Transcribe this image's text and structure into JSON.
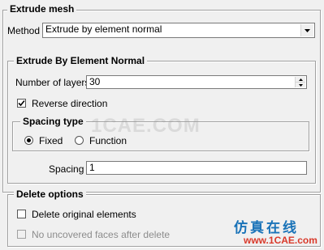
{
  "extrude_mesh": {
    "title": "Extrude mesh",
    "method_label": "Method",
    "method_value": "Extrude by element normal"
  },
  "by_normal": {
    "title": "Extrude By Element Normal",
    "layers_label": "Number of layers",
    "layers_value": "30",
    "reverse_label": "Reverse direction",
    "reverse_checked": true,
    "spacing_type": {
      "title": "Spacing type",
      "fixed_label": "Fixed",
      "function_label": "Function",
      "selected": "Fixed"
    },
    "spacing_label": "Spacing",
    "spacing_value": "1"
  },
  "delete_options": {
    "title": "Delete options",
    "delete_original_label": "Delete original elements",
    "delete_original_checked": false,
    "no_uncovered_label": "No uncovered faces after delete",
    "no_uncovered_checked": false,
    "no_uncovered_disabled": true
  },
  "watermark": {
    "text": "1CAE.COM",
    "logo_cn": "仿真在线",
    "logo_url": "www.1CAE.com"
  }
}
